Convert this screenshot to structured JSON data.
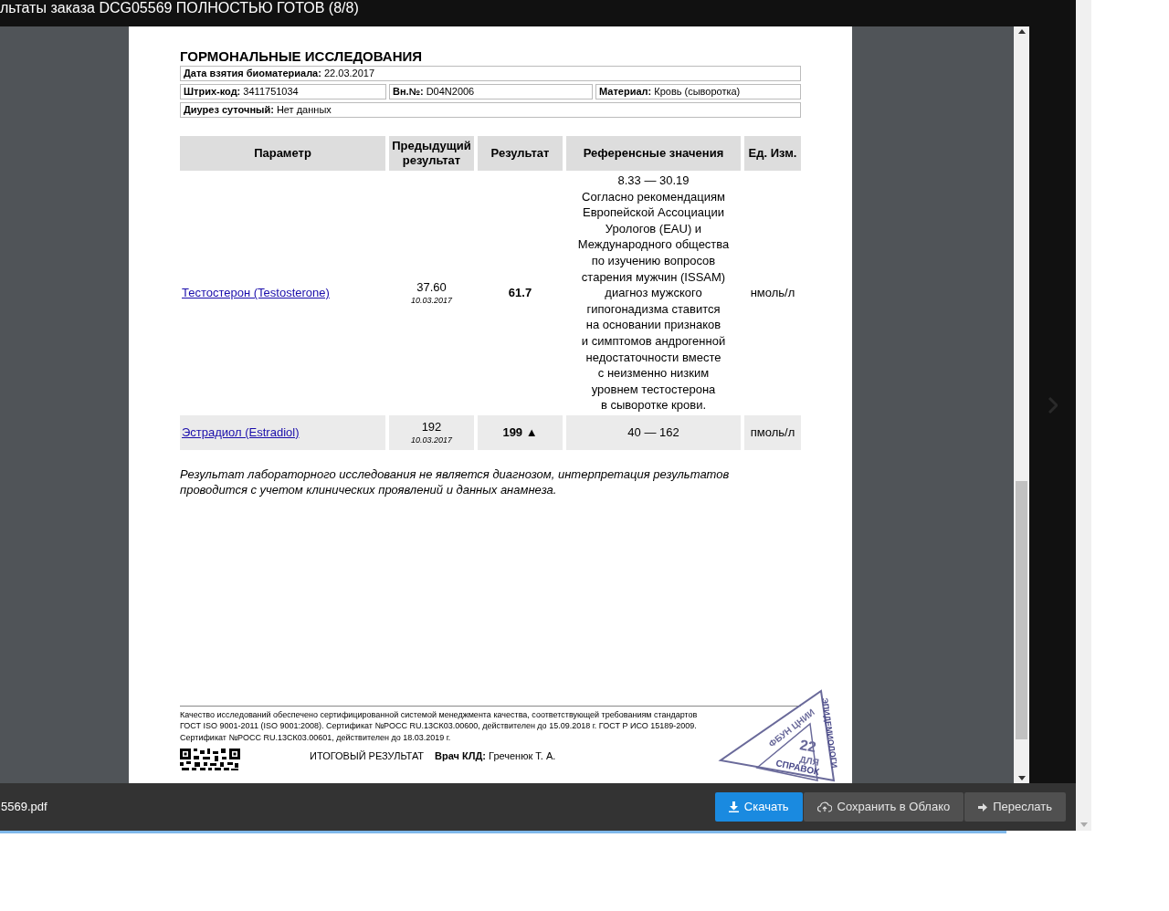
{
  "window": {
    "title": "льтаты заказа DCG05569 ПОЛНОСТЬЮ ГОТОВ (8/8)"
  },
  "document": {
    "heading": "ГОРМОНАЛЬНЫЕ ИССЛЕДОВАНИЯ",
    "info_rows": [
      [
        {
          "label": "Дата взятия биоматериала:",
          "value": "22.03.2017"
        }
      ],
      [
        {
          "label": "Штрих-код:",
          "value": "3411751034"
        },
        {
          "label": "Вн.№:",
          "value": "D04N2006"
        },
        {
          "label": "Материал:",
          "value": "Кровь (сыворотка)"
        }
      ],
      [
        {
          "label": "Диурез суточный:",
          "value": "Нет данных"
        }
      ]
    ],
    "table": {
      "columns": [
        "Параметр",
        "Предыдущий результат",
        "Результат",
        "Референсные значения",
        "Ед. Изм."
      ],
      "rows": [
        {
          "parameter": "Тестостерон (Testosterone)",
          "previous": "37.60",
          "previous_date": "10.03.2017",
          "result": "61.7",
          "reference": [
            "8.33 — 30.19",
            "Согласно рекомендациям",
            "Европейской Ассоциации",
            "Урологов (EAU) и",
            "Международного общества",
            "по изучению вопросов",
            "старения мужчин (ISSAM)",
            "диагноз мужского",
            "гипогонадизма ставится",
            "на основании признаков",
            "и симптомов андрогенной",
            "недостаточности вместе",
            "с неизменно низким",
            "уровнем тестостерона",
            "в сыворотке крови."
          ],
          "unit": "нмоль/л"
        },
        {
          "parameter": "Эстрадиол (Estradiol)",
          "previous": "192",
          "previous_date": "10.03.2017",
          "result": "199 ▲",
          "reference": [
            "40 — 162"
          ],
          "unit": "пмоль/л"
        }
      ]
    },
    "note": "Результат лабораторного исследования не является диагнозом, интерпретация результатов  проводится с учетом клинических проявлений и данных анамнеза.",
    "footer": {
      "certification": "Качество исследований обеспечено сертифицированной системой менеджмента качества, соответствующей требованиям стандартов ГОСТ ISO 9001-2011 (ISO 9001:2008). Сертификат №РОСС RU.13СК03.00600, действителен до 15.09.2018 г. ГОСТ Р ИСО 15189-2009. Сертификат №РОСС RU.13СК03.00601, действителен до 18.03.2019 г.",
      "final_label": "ИТОГОВЫЙ РЕЗУЛЬТАТ",
      "doctor_label": "Врач КЛД:",
      "doctor_name": "Греченюк Т. А."
    },
    "stamp": {
      "organization": "ФБУН ЦНИИ",
      "number": "22",
      "purpose": [
        "ДЛЯ",
        "СПРАВОК"
      ],
      "side": "ЭПИДЕМИОЛОГИ"
    }
  },
  "bottom_bar": {
    "filename": "5569.pdf",
    "buttons": [
      {
        "kind": "download",
        "label": "Скачать",
        "primary": true
      },
      {
        "kind": "cloud",
        "label": "Сохранить в Облако",
        "primary": false
      },
      {
        "kind": "forward",
        "label": "Переслать",
        "primary": false
      }
    ]
  }
}
